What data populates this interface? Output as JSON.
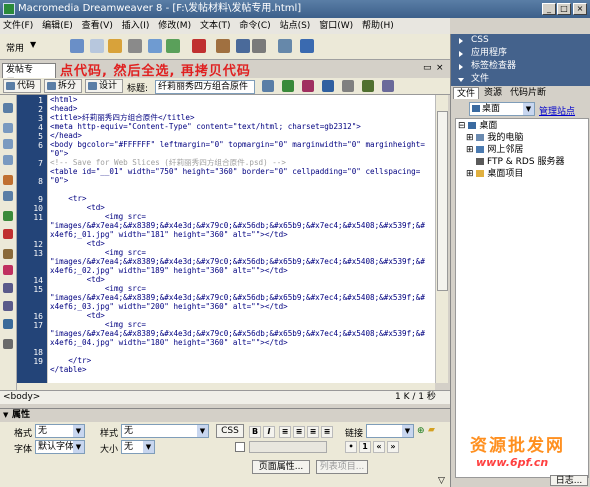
{
  "window": {
    "title": "Macromedia Dreamweaver 8 - [F:\\发帖材料\\发帖专用.html]",
    "min": "_",
    "max": "□",
    "close": "×"
  },
  "menu": [
    "文件(F)",
    "编辑(E)",
    "查看(V)",
    "插入(I)",
    "修改(M)",
    "文本(T)",
    "命令(C)",
    "站点(S)",
    "窗口(W)",
    "帮助(H)"
  ],
  "insertbar": {
    "category": "常用"
  },
  "document": {
    "tab": "发帖专用.html",
    "annotation": "点代码, 然后全选, 再拷贝代码",
    "view_buttons": [
      "代码",
      "拆分",
      "设计"
    ],
    "title_label": "标题:",
    "title_value": "纤莉丽秀四方组合原件"
  },
  "code": {
    "gutter": [
      "1",
      "2",
      "3",
      "4",
      "5",
      "6",
      "",
      "7",
      "",
      "8",
      "9",
      "10",
      "11",
      "",
      "12",
      "13",
      "",
      "14",
      "15",
      "",
      "16",
      "17",
      "",
      "18",
      "19"
    ],
    "lines": [
      "<html>",
      "<head>",
      "<title>纤莉丽秀四方组合原件</title>",
      "<meta http-equiv=\"Content-Type\" content=\"text/html; charset=gb2312\">",
      "</head>",
      "<body bgcolor=\"#FFFFFF\" leftmargin=\"0\" topmargin=\"0\" marginwidth=\"0\" marginheight=",
      "\"0\">",
      "<!-- Save for Web Slices (纤莉丽秀四方组合原件.psd) -->",
      "<table id=\"__01\" width=\"750\" height=\"360\" border=\"0\" cellpadding=\"0\" cellspacing=",
      "\"0\">",
      "    <tr>",
      "        <td>",
      "            <img src=",
      "\"images/&#x7ea4;&#x8389;&#x4e3d;&#x79c0;&#x56db;&#x65b9;&#x7ec4;&#x5408;&#x539f;&#",
      "x4ef6;_01.jpg\" width=\"181\" height=\"360\" alt=\"\"></td>",
      "        <td>",
      "            <img src=",
      "\"images/&#x7ea4;&#x8389;&#x4e3d;&#x79c0;&#x56db;&#x65b9;&#x7ec4;&#x5408;&#x539f;&#",
      "x4ef6;_02.jpg\" width=\"189\" height=\"360\" alt=\"\"></td>",
      "        <td>",
      "            <img src=",
      "\"images/&#x7ea4;&#x8389;&#x4e3d;&#x79c0;&#x56db;&#x65b9;&#x7ec4;&#x5408;&#x539f;&#",
      "x4ef6;_03.jpg\" width=\"200\" height=\"360\" alt=\"\"></td>",
      "        <td>",
      "            <img src=",
      "\"images/&#x7ea4;&#x8389;&#x4e3d;&#x79c0;&#x56db;&#x65b9;&#x7ec4;&#x5408;&#x539f;&#",
      "x4ef6;_04.jpg\" width=\"180\" height=\"360\" alt=\"\"></td>",
      "    </tr>",
      "</table>"
    ]
  },
  "status": {
    "tag": "<body>",
    "position": "1 K / 1 秒"
  },
  "properties": {
    "header": "属性",
    "format_label": "格式",
    "format_value": "无",
    "style_label": "样式",
    "style_value": "无",
    "css_button": "CSS",
    "bold": "B",
    "italic": "I",
    "link_label": "链接",
    "font_label": "字体",
    "font_value": "默认字体",
    "size_label": "大小",
    "size_value": "无",
    "page_props": "页面属性...",
    "list_item": "列表项目..."
  },
  "panels": {
    "css": "CSS",
    "app": "应用程序",
    "tag_inspector": "标签检查器",
    "files": "文件",
    "file_tabs": [
      "文件",
      "资源",
      "代码片断"
    ],
    "site": "桌面",
    "manage_sites": "管理站点",
    "tree": [
      "桌面",
      "我的电脑",
      "网上邻居",
      "FTP & RDS 服务器",
      "桌面项目"
    ],
    "log_button": "日志..."
  },
  "watermark": {
    "text": "资源批发网",
    "url": "www.6pf.cn"
  }
}
